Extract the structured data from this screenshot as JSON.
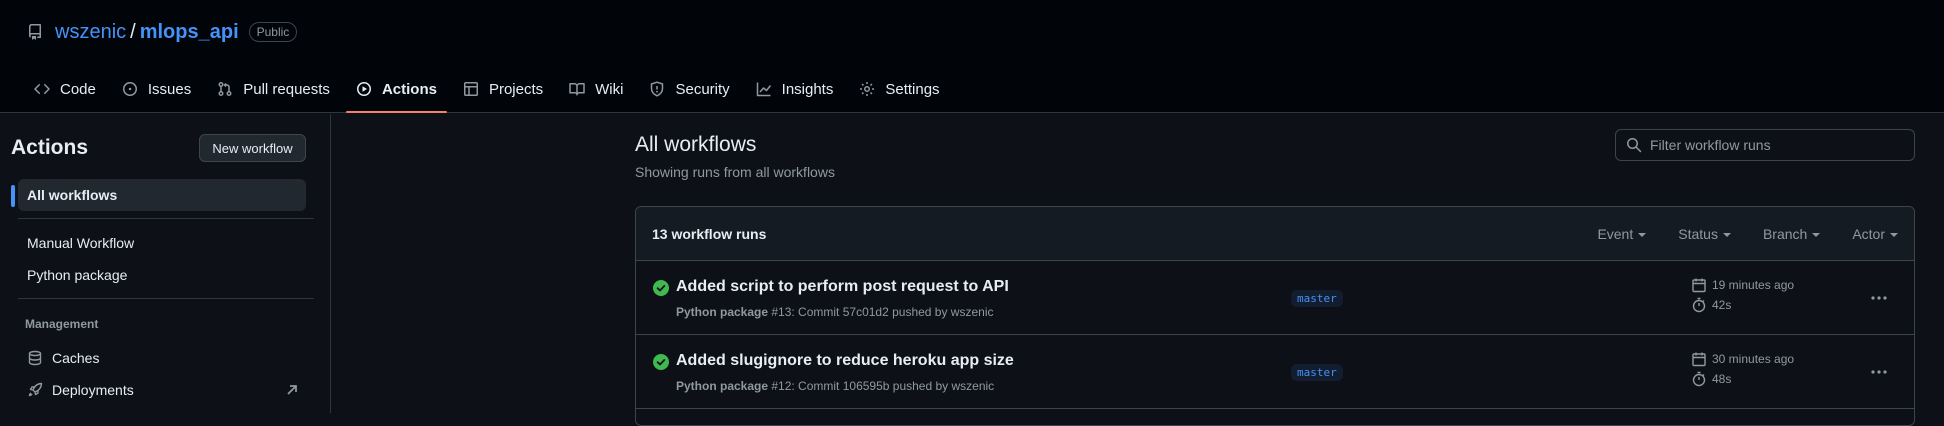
{
  "repo": {
    "owner": "wszenic",
    "slash": "/",
    "name": "mlops_api",
    "visibility": "Public"
  },
  "nav": [
    {
      "label": "Code",
      "icon": "code-icon"
    },
    {
      "label": "Issues",
      "icon": "issue-icon"
    },
    {
      "label": "Pull requests",
      "icon": "pull-request-icon"
    },
    {
      "label": "Actions",
      "icon": "play-icon",
      "active": true
    },
    {
      "label": "Projects",
      "icon": "table-icon"
    },
    {
      "label": "Wiki",
      "icon": "book-icon"
    },
    {
      "label": "Security",
      "icon": "shield-icon"
    },
    {
      "label": "Insights",
      "icon": "graph-icon"
    },
    {
      "label": "Settings",
      "icon": "gear-icon"
    }
  ],
  "sidebar": {
    "title": "Actions",
    "new_workflow": "New workflow",
    "all_workflows": "All workflows",
    "workflows": [
      "Manual Workflow",
      "Python package"
    ],
    "management_heading": "Management",
    "management": [
      {
        "label": "Caches",
        "icon": "database-icon"
      },
      {
        "label": "Deployments",
        "icon": "rocket-icon"
      }
    ]
  },
  "main": {
    "title": "All workflows",
    "subtitle": "Showing runs from all workflows",
    "filter_placeholder": "Filter workflow runs",
    "runs_count": "13 workflow runs",
    "filters": [
      "Event",
      "Status",
      "Branch",
      "Actor"
    ],
    "runs": [
      {
        "title": "Added script to perform post request to API",
        "workflow": "Python package",
        "detail": " #13: Commit 57c01d2 pushed by wszenic",
        "branch": "master",
        "time": "19 minutes ago",
        "duration": "42s",
        "status": "success"
      },
      {
        "title": "Added slugignore to reduce heroku app size",
        "workflow": "Python package",
        "detail": " #12: Commit 106595b pushed by wszenic",
        "branch": "master",
        "time": "30 minutes ago",
        "duration": "48s",
        "status": "success"
      }
    ]
  },
  "colors": {
    "accent": "#4493f8",
    "active_tab_underline": "#f78166",
    "success": "#3fb950",
    "background": "#0d1117",
    "header_background": "#010409",
    "muted_text": "#9198a1"
  }
}
